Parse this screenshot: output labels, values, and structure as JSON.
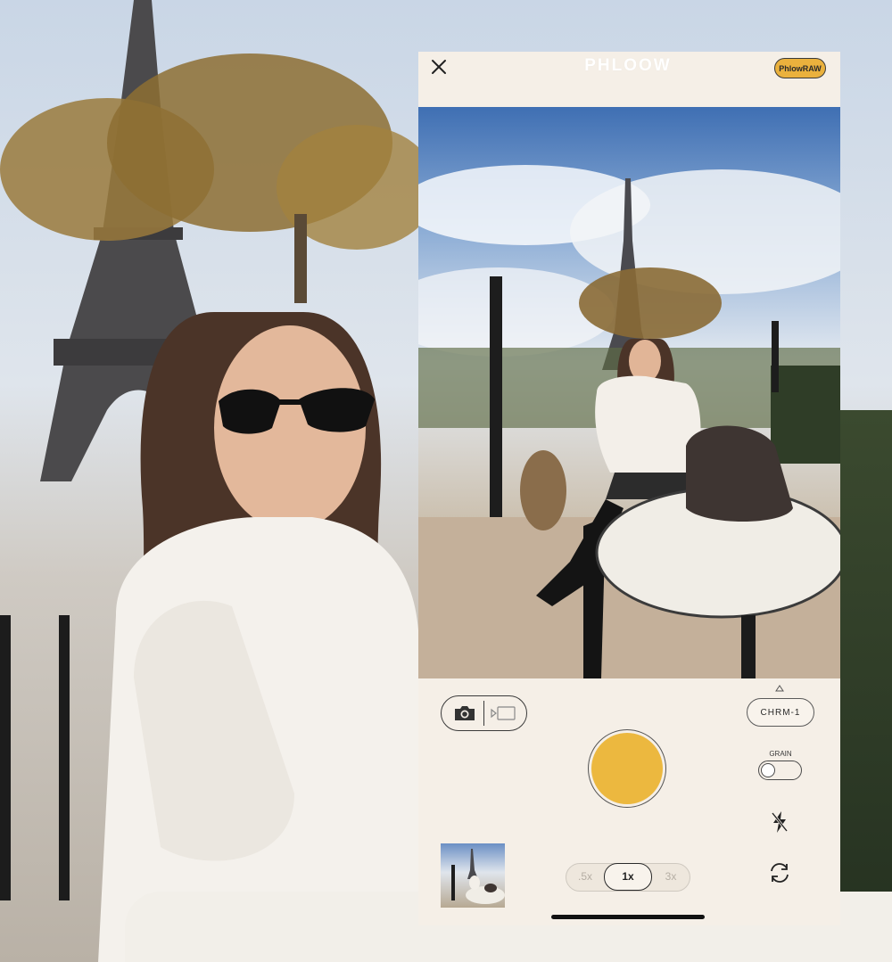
{
  "app": {
    "logo": "PHLOOW",
    "raw_badge": "PhlowRAW"
  },
  "camera": {
    "film_preset": "CHRM-1",
    "grain_label": "GRAIN",
    "grain_enabled": false,
    "zoom_options": [
      ".5x",
      "1x",
      "3x"
    ],
    "zoom_selected": "1x"
  },
  "colors": {
    "background": "#f5efe7",
    "shutter": "#ecb83f",
    "badge": "#eab13d"
  },
  "icons": {
    "close": "close-icon",
    "photo": "camera-icon",
    "video": "video-icon",
    "flash": "flash-off-icon",
    "flip": "flip-camera-icon",
    "film_up": "chevron-up-icon"
  }
}
